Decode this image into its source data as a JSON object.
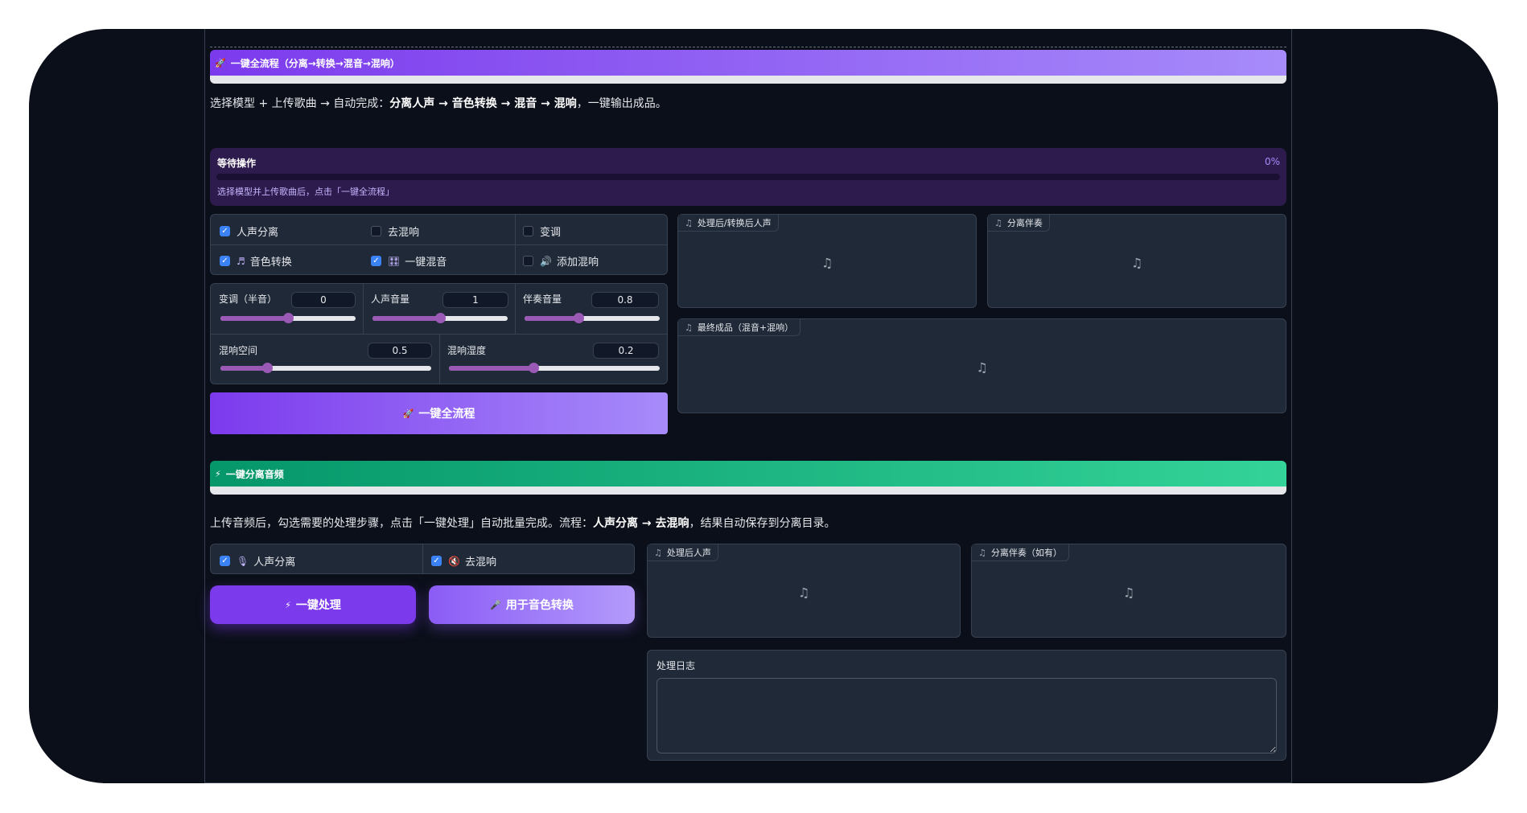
{
  "full_flow": {
    "banner_icon": "rocket-icon",
    "banner_title": "一键全流程（分离→转换→混音→混响）",
    "desc_plain": "选择模型 + 上传歌曲 → 自动完成：",
    "desc_bold": "分离人声 → 音色转换 → 混音 → 混响",
    "desc_tail": "，一键输出成品。",
    "status_title": "等待操作",
    "status_pct": "0%",
    "status_progress": 0,
    "status_hint": "选择模型并上传歌曲后，点击「一键全流程」",
    "checks": [
      {
        "label": "人声分离",
        "checked": true,
        "icon": ""
      },
      {
        "label": "去混响",
        "checked": false,
        "icon": ""
      },
      {
        "label": "变调",
        "checked": false,
        "icon": ""
      },
      {
        "label": "音色转换",
        "checked": true,
        "icon": "music-note-icon"
      },
      {
        "label": "一键混音",
        "checked": true,
        "icon": "mixer-icon"
      },
      {
        "label": "添加混响",
        "checked": false,
        "icon": "speaker-icon"
      }
    ],
    "sliders": [
      {
        "label": "变调（半音）",
        "value": "0",
        "fraction": 0.5
      },
      {
        "label": "人声音量",
        "value": "1",
        "fraction": 0.5
      },
      {
        "label": "伴奏音量",
        "value": "0.8",
        "fraction": 0.4
      },
      {
        "label": "混响空间",
        "value": "0.5",
        "fraction": 0.22
      },
      {
        "label": "混响湿度",
        "value": "0.2",
        "fraction": 0.4
      }
    ],
    "run_button": "一键全流程",
    "audio": {
      "vocal": "处理后/转换后人声",
      "accomp": "分离伴奏",
      "final": "最终成品（混音+混响）"
    }
  },
  "separate": {
    "banner_icon": "lightning-icon",
    "banner_title": "一键分离音频",
    "desc_plain": "上传音频后，勾选需要的处理步骤，点击「一键处理」自动批量完成。流程：",
    "desc_bold": "人声分离 → 去混响",
    "desc_tail": "，结果自动保存到分离目录。",
    "checks": [
      {
        "label": "人声分离",
        "checked": true,
        "icon": "microphone-icon"
      },
      {
        "label": "去混响",
        "checked": true,
        "icon": "mute-icon"
      }
    ],
    "process_button": "一键处理",
    "use_button": "用于音色转换",
    "audio": {
      "vocal": "处理后人声",
      "accomp": "分离伴奏（如有）"
    },
    "log_label": "处理日志",
    "log_value": ""
  },
  "colors": {
    "purple_accent": "#8b5cf6",
    "green_accent": "#10b981",
    "checkbox_on": "#3b82f6"
  }
}
